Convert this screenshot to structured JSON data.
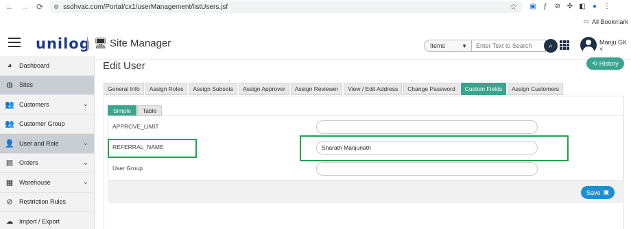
{
  "browser": {
    "url": "ssdhvac.com/Portal/cx1/userManagement/listUsers.jsf",
    "bookmarks_label": "All Bookmark"
  },
  "header": {
    "logo": "unilog",
    "app_name": "Site Manager",
    "search_category": "Items",
    "search_placeholder": "Enter Text to Search",
    "user_name": "Manju GK"
  },
  "sidebar": {
    "items": [
      {
        "label": "Dashboard",
        "icon": "dashboard-icon",
        "chevron": false,
        "active": false
      },
      {
        "label": "Sites",
        "icon": "globe-icon",
        "chevron": false,
        "active": true
      },
      {
        "label": "Customers",
        "icon": "users-icon",
        "chevron": true,
        "active": false
      },
      {
        "label": "Customer Group",
        "icon": "user-group-icon",
        "chevron": false,
        "active": false
      },
      {
        "label": "User and Role",
        "icon": "user-role-icon",
        "chevron": true,
        "active": true
      },
      {
        "label": "Orders",
        "icon": "orders-icon",
        "chevron": true,
        "active": false
      },
      {
        "label": "Warehouse",
        "icon": "warehouse-icon",
        "chevron": true,
        "active": false
      },
      {
        "label": "Restriction Rules",
        "icon": "ban-icon",
        "chevron": false,
        "active": false
      },
      {
        "label": "Import / Export",
        "icon": "cloud-upload-icon",
        "chevron": false,
        "active": false
      }
    ]
  },
  "main": {
    "title": "Edit User",
    "history_label": "History",
    "tabs": [
      {
        "label": "General Info",
        "active": false
      },
      {
        "label": "Assign Roles",
        "active": false
      },
      {
        "label": "Assign Subsets",
        "active": false
      },
      {
        "label": "Assign Approver",
        "active": false
      },
      {
        "label": "Assign Reviewer",
        "active": false
      },
      {
        "label": "View / Edit Address",
        "active": false
      },
      {
        "label": "Change Password",
        "active": false
      },
      {
        "label": "Custom Fields",
        "active": true
      },
      {
        "label": "Assign Customers",
        "active": false
      }
    ],
    "subtabs": [
      {
        "label": "Simple",
        "active": true
      },
      {
        "label": "Table",
        "active": false
      }
    ],
    "fields": [
      {
        "label": "APPROVE_LIMIT",
        "value": ""
      },
      {
        "label": "REFERRAL_NAME",
        "value": "Sharath Manjunath"
      },
      {
        "label": "User Group",
        "value": ""
      }
    ],
    "save_label": "Save"
  },
  "colors": {
    "accent_teal": "#3aa58e",
    "save_blue": "#1c8fd0",
    "highlight_green": "#1fa34a",
    "brand_navy": "#1e3a8a"
  }
}
